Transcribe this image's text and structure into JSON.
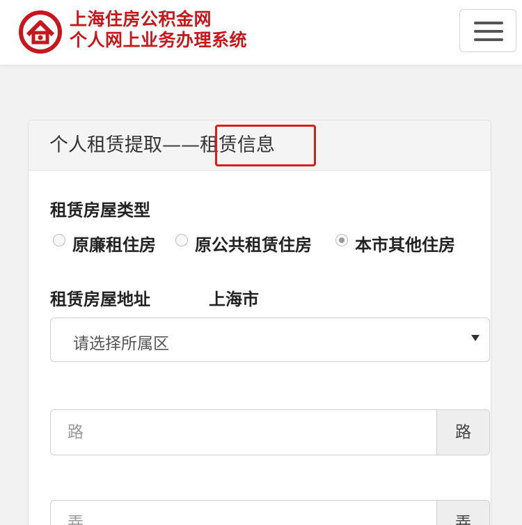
{
  "header": {
    "brand_line1": "上海住房公积金网",
    "brand_line2": "个人网上业务办理系统",
    "brand_color": "#c8161d"
  },
  "panel": {
    "title": "个人租赁提取——租赁信息",
    "highlight_color": "#d5211d"
  },
  "form": {
    "house_type_label": "租赁房屋类型",
    "house_type_options": [
      {
        "label": "原廉租住房",
        "checked": false
      },
      {
        "label": "原公共租赁住房",
        "checked": false
      },
      {
        "label": "本市其他住房",
        "checked": true
      }
    ],
    "address_label": "租赁房屋地址",
    "city": "上海市",
    "district_select": {
      "value": "请选择所属区"
    },
    "road_input": {
      "placeholder": "路",
      "addon": "路"
    },
    "lane_input": {
      "placeholder": "弄",
      "addon": "弄"
    }
  },
  "icons": {
    "logo": "house-logo-icon",
    "menu": "hamburger-menu-icon"
  }
}
